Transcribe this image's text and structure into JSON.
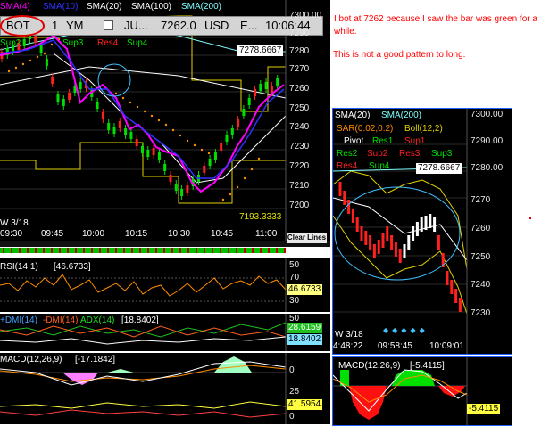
{
  "colors": {
    "bg": "#000000",
    "up": "#00e000",
    "down": "#ff2020",
    "sma4": "#ff00ff",
    "sma10": "#3030ff",
    "sma20": "#ffffff",
    "sma100": "#ffffff",
    "sma200": "#80ffff",
    "note": "#ff0000",
    "axis": "#e8e8e8"
  },
  "main": {
    "legend": {
      "sma4": "SMA(4)",
      "sma10": "SMA(10)",
      "sma20": "SMA(20)",
      "sma100": "SMA(100)",
      "sma200": "SMA(200)"
    },
    "quote": {
      "bot": "BOT",
      "qty": "1",
      "symbol": "YM",
      "expiry": "JU...",
      "price": "7262.0",
      "currency": "USD",
      "ellipsis": "E...",
      "time": "10:06:44"
    },
    "pivots": {
      "sup2": "Sup2",
      "sup3": "Sup3",
      "res4": "Res4",
      "sup4": "Sup4"
    },
    "price_tags": {
      "top": "7278.6667",
      "bottom": "7193.3333"
    },
    "yticks": [
      "7300.00",
      "7290",
      "7280",
      "7270",
      "7260",
      "7250",
      "7240",
      "7230",
      "7220",
      "7210",
      "7200"
    ],
    "xticks": [
      "09:30",
      "09:45",
      "10:00",
      "10:15",
      "10:30",
      "10:45",
      "11:00"
    ],
    "date_label": "W 3/18",
    "clear_lines": "Clear Lines"
  },
  "rsi": {
    "label": "RSI(14,1)",
    "value": "[46.6733]",
    "ticks": [
      "70",
      "50",
      "30"
    ],
    "current": "46.6733"
  },
  "dmi": {
    "plus": "+DMI(14)",
    "minus": "-DMI(14)",
    "adx": "ADX(14)",
    "value": "[18.8402]",
    "ticks": [
      "50",
      "25",
      "0"
    ],
    "tag1": "28.6159",
    "tag2": "18.8402"
  },
  "macd": {
    "label": "MACD(12,26,9)",
    "value": "[-17.1842]",
    "ticks": [
      "0",
      "25",
      "0"
    ],
    "tag": "41.5954"
  },
  "note": {
    "line1": "I bot at 7262 because I saw the bar was green for a while.",
    "line2": "This is not a good pattern to long."
  },
  "side": {
    "legend": {
      "sma20": "SMA(20)",
      "sma200": "SMA(200)",
      "sar": "SAR(0.02,0.2)",
      "boll": "Boll(12,2)",
      "pivot": "Pivot",
      "res1": "Res1",
      "sup1": "Sup1",
      "res2": "Res2",
      "sup2": "Sup2",
      "res3": "Res3",
      "sup3": "Sup3",
      "res4": "Res4",
      "sup4": "Sup4"
    },
    "price_tag": "7278.6667",
    "yticks": [
      "7300.00",
      "7290.00",
      "7280.00",
      "7270",
      "7260",
      "7250",
      "7240",
      "7230"
    ],
    "date_label": "W 3/18",
    "xticks": [
      "4:48:22",
      "09:58:45",
      "10:09:01"
    ],
    "macd_label": "MACD(12,26,9)",
    "macd_value": "[-5.4115]",
    "macd_tag": "-5.4115"
  }
}
